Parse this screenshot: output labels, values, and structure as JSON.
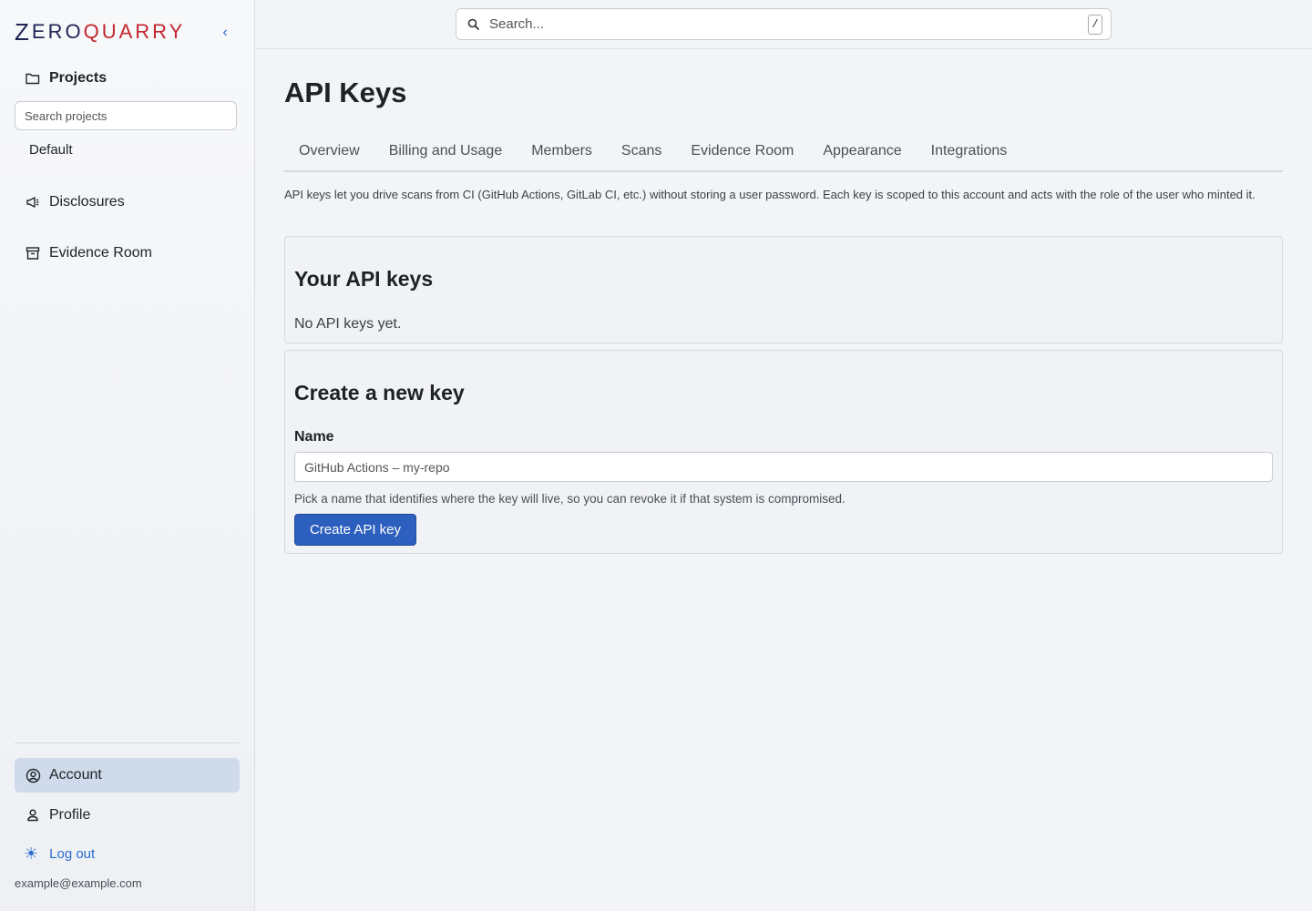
{
  "brand": {
    "logo_text_z": "Z",
    "logo_text_ero": "ERO",
    "logo_text_quarry": "QUARRY",
    "primary_color": "#2c5fbe",
    "accent_red": "#c4272f",
    "navy": "#1f2555"
  },
  "sidebar": {
    "collapse_icon": "chevron-left-icon",
    "projects_label": "Projects",
    "search_placeholder": "Search projects",
    "project_items": [
      "Default"
    ],
    "disclosures_label": "Disclosures",
    "evidence_label": "Evidence Room",
    "account_label": "Account",
    "profile_label": "Profile",
    "logout_label": "Log out",
    "user_email": "example@example.com"
  },
  "topbar": {
    "search_placeholder": "Search...",
    "shortcut_key": "/"
  },
  "main": {
    "title": "API Keys",
    "tabs": [
      "Overview",
      "Billing and Usage",
      "Members",
      "Scans",
      "Evidence Room",
      "Appearance",
      "Integrations"
    ],
    "intro": "API keys let you drive scans from CI (GitHub Actions, GitLab CI, etc.) without storing a user password. Each key is scoped to this account and acts with the role of the user who minted it.",
    "keys_card": {
      "title": "Your API keys",
      "empty_text": "No API keys yet."
    },
    "create_card": {
      "title": "Create a new key",
      "name_label": "Name",
      "name_placeholder": "GitHub Actions – my-repo",
      "help_text": "Pick a name that identifies where the key will live, so you can revoke it if that system is compromised.",
      "button_label": "Create API key"
    }
  }
}
